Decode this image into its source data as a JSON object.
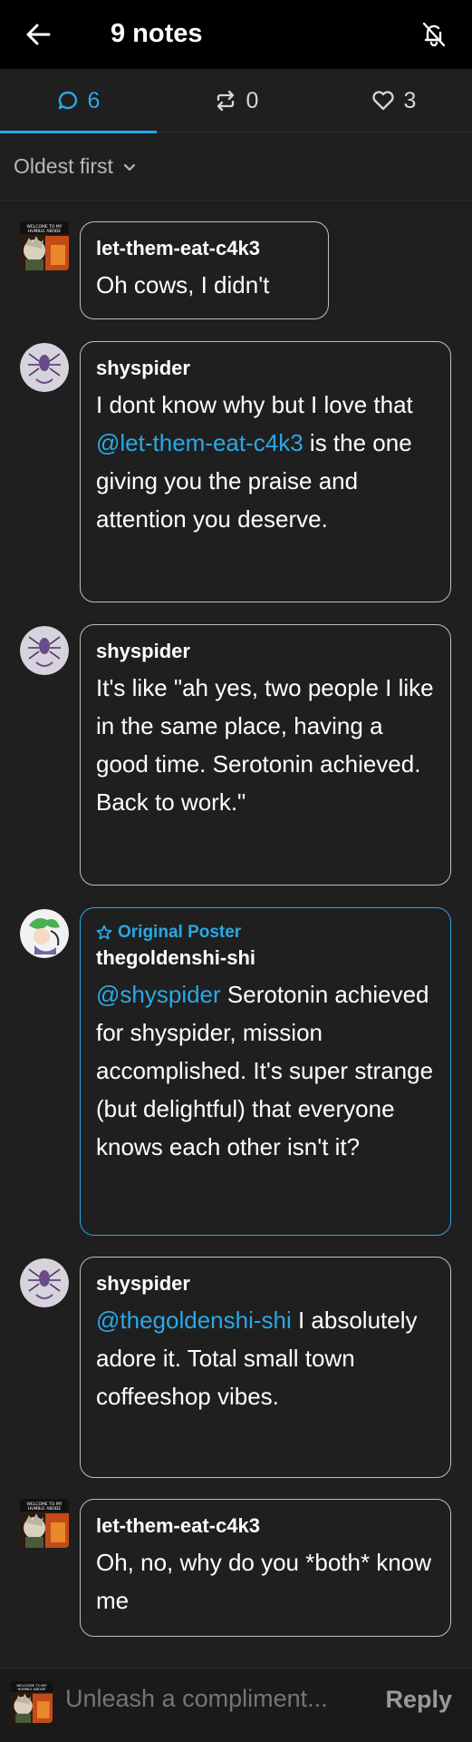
{
  "header": {
    "title": "9 notes",
    "back_icon": "arrow-left-icon",
    "mute_icon": "bell-off-icon"
  },
  "tabs": [
    {
      "icon": "comment-icon",
      "count": "6",
      "active": true
    },
    {
      "icon": "reblog-icon",
      "count": "0",
      "active": false
    },
    {
      "icon": "heart-icon",
      "count": "3",
      "active": false
    }
  ],
  "sort": {
    "label": "Oldest first",
    "icon": "chevron-down-icon"
  },
  "comments": [
    {
      "author": "let-them-eat-c4k3",
      "avatar": "meme-avatar",
      "text": "Oh cows, I didn't"
    },
    {
      "author": "shyspider",
      "avatar": "spider-avatar",
      "text_before": "I dont know why but I love that ",
      "mention": "@let-them-eat-c4k3",
      "text_after": " is the one giving you the praise and attention you deserve."
    },
    {
      "author": "shyspider",
      "avatar": "spider-avatar",
      "text": "It's like \"ah yes, two people I like in the same place, having a good time. Serotonin achieved. Back to work.\""
    },
    {
      "author": "thegoldenshi-shi",
      "avatar": "op-avatar",
      "op_label": "Original Poster",
      "mention": "@shyspider",
      "text_after": " Serotonin achieved for shyspider, mission accomplished. It's super strange (but delightful) that everyone knows each other isn't it?"
    },
    {
      "author": "shyspider",
      "avatar": "spider-avatar",
      "mention": "@thegoldenshi-shi",
      "text_after": " I absolutely adore it. Total small town coffeeshop vibes."
    },
    {
      "author": "let-them-eat-c4k3",
      "avatar": "meme-avatar",
      "text": "Oh, no, why do you *both* know me"
    }
  ],
  "footer": {
    "placeholder": "Unleash a compliment...",
    "reply_label": "Reply"
  },
  "colors": {
    "accent": "#2aa8e6",
    "background": "#1f1f1f",
    "header": "#000000"
  }
}
